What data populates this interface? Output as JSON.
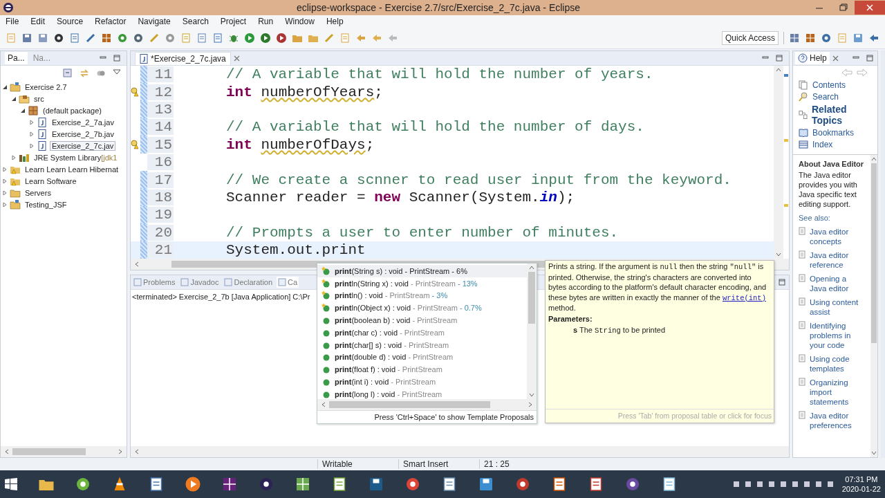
{
  "window": {
    "title": "eclipse-workspace - Exercise 2.7/src/Exercise_2_7c.java - Eclipse"
  },
  "menu": [
    "File",
    "Edit",
    "Source",
    "Refactor",
    "Navigate",
    "Search",
    "Project",
    "Run",
    "Window",
    "Help"
  ],
  "toolbar": {
    "quick_access": "Quick Access"
  },
  "package_explorer": {
    "tabs": [
      {
        "label": "Pa...",
        "selected": true
      },
      {
        "label": "Na...",
        "selected": false
      }
    ],
    "tree": [
      {
        "label": "Exercise 2.7",
        "kind": "project",
        "expanded": true,
        "selected": false,
        "children": [
          {
            "label": "src",
            "kind": "source-folder",
            "expanded": true,
            "selected": false,
            "children": [
              {
                "label": "(default package)",
                "kind": "package",
                "expanded": true,
                "selected": false,
                "children": [
                  {
                    "label": "Exercise_2_7a.jav",
                    "kind": "java-file",
                    "expanded": false,
                    "selected": false
                  },
                  {
                    "label": "Exercise_2_7b.jav",
                    "kind": "java-file",
                    "expanded": false,
                    "selected": false
                  },
                  {
                    "label": "Exercise_2_7c.jav",
                    "kind": "java-file",
                    "expanded": false,
                    "selected": true
                  }
                ]
              }
            ]
          },
          {
            "label": "JRE System Library",
            "suffix": "[jdk1",
            "kind": "library",
            "expanded": false,
            "selected": false
          }
        ]
      },
      {
        "label": "Learn Learn Learn Hibernat",
        "kind": "warning-project",
        "expanded": false,
        "selected": false
      },
      {
        "label": "Learn Software",
        "kind": "warning-project",
        "expanded": false,
        "selected": false
      },
      {
        "label": "Servers",
        "kind": "folder",
        "expanded": false,
        "selected": false
      },
      {
        "label": "Testing_JSF",
        "kind": "project",
        "expanded": false,
        "selected": false
      }
    ]
  },
  "editor": {
    "tab": "*Exercise_2_7c.java",
    "lines": [
      {
        "number": "11",
        "changed": true,
        "warning": false,
        "current": false,
        "tokens": [
          {
            "text": "// A variable that will hold the number of years.",
            "kind": "comment"
          }
        ]
      },
      {
        "number": "12",
        "changed": true,
        "warning": true,
        "current": false,
        "tokens": [
          {
            "text": "int ",
            "kind": "keyword"
          },
          {
            "text": "numberOfYears",
            "kind": "warning"
          },
          {
            "text": ";",
            "kind": "plain"
          }
        ]
      },
      {
        "number": "13",
        "changed": true,
        "warning": false,
        "current": false
      },
      {
        "number": "14",
        "changed": true,
        "warning": false,
        "current": false,
        "tokens": [
          {
            "text": "// A variable that will hold the number of days.",
            "kind": "comment"
          }
        ]
      },
      {
        "number": "15",
        "changed": true,
        "warning": true,
        "current": false,
        "tokens": [
          {
            "text": "int ",
            "kind": "keyword"
          },
          {
            "text": "numberOfDays",
            "kind": "warning"
          },
          {
            "text": ";",
            "kind": "plain"
          }
        ]
      },
      {
        "number": "16",
        "changed": false,
        "warning": false,
        "current": false
      },
      {
        "number": "17",
        "changed": true,
        "warning": false,
        "current": false,
        "tokens": [
          {
            "text": "// We create a scnner to read user input from the keyword.",
            "kind": "comment"
          }
        ]
      },
      {
        "number": "18",
        "changed": true,
        "warning": false,
        "current": false,
        "tokens": [
          {
            "text": "Scanner reader = ",
            "kind": "plain"
          },
          {
            "text": "new",
            "kind": "keyword"
          },
          {
            "text": " Scanner(System.",
            "kind": "plain"
          },
          {
            "text": "in",
            "kind": "static-field"
          },
          {
            "text": ");",
            "kind": "plain"
          }
        ]
      },
      {
        "number": "19",
        "changed": true,
        "warning": false,
        "current": false
      },
      {
        "number": "20",
        "changed": true,
        "warning": false,
        "current": false,
        "tokens": [
          {
            "text": "// Prompts a user to enter number of minutes.",
            "kind": "comment"
          }
        ]
      },
      {
        "number": "21",
        "changed": true,
        "warning": false,
        "current": true,
        "tokens": [
          {
            "text": "System.out.print",
            "kind": "plain"
          }
        ]
      }
    ]
  },
  "bottom_panel": {
    "tabs": [
      {
        "label": "Problems",
        "selected": false
      },
      {
        "label": "Javadoc",
        "selected": false
      },
      {
        "label": "Declaration",
        "selected": false
      },
      {
        "label": "Ca",
        "selected": true
      }
    ],
    "console": "<terminated> Exercise_2_7b [Java Application] C:\\Pr"
  },
  "content_assist": {
    "proposals": [
      {
        "name": "print",
        "signature": "(String s) : void",
        "type": "- PrintStream",
        "percent": "- 6%",
        "starred": true,
        "selected": true
      },
      {
        "name": "print",
        "signature": "ln(String x) : void",
        "type": "- PrintStream",
        "percent": "- 13%",
        "starred": true,
        "selected": false
      },
      {
        "name": "print",
        "signature": "ln() : void",
        "type": "- PrintStream",
        "percent": "- 3%",
        "starred": true,
        "selected": false
      },
      {
        "name": "print",
        "signature": "ln(Object x) : void",
        "type": "- PrintStream",
        "percent": "- 0.7%",
        "starred": true,
        "selected": false
      },
      {
        "name": "print",
        "signature": "(boolean b) : void",
        "type": "- PrintStream",
        "starred": false,
        "selected": false
      },
      {
        "name": "print",
        "signature": "(char c) : void",
        "type": "- PrintStream",
        "starred": false,
        "selected": false
      },
      {
        "name": "print",
        "signature": "(char[] s) : void",
        "type": "- PrintStream",
        "starred": false,
        "selected": false
      },
      {
        "name": "print",
        "signature": "(double d) : void",
        "type": "- PrintStream",
        "starred": false,
        "selected": false
      },
      {
        "name": "print",
        "signature": "(float f) : void",
        "type": "- PrintStream",
        "starred": false,
        "selected": false
      },
      {
        "name": "print",
        "signature": "(int i) : void",
        "type": "- PrintStream",
        "starred": false,
        "selected": false
      },
      {
        "name": "print",
        "signature": "(long l) : void",
        "type": "- PrintStream",
        "starred": false,
        "selected": false
      }
    ],
    "footer": "Press 'Ctrl+Space' to show Template Proposals",
    "doc": {
      "description": [
        {
          "text": "Prints a string. If the argument is ",
          "kind": "text"
        },
        {
          "text": "null",
          "kind": "code"
        },
        {
          "text": " then the string ",
          "kind": "text"
        },
        {
          "text": "\"null\"",
          "kind": "code"
        },
        {
          "text": " is printed. Otherwise, the string's characters are converted into bytes according to the platform's default character encoding, and these bytes are written in exactly the manner of the ",
          "kind": "text"
        },
        {
          "text": "write(int)",
          "kind": "link"
        },
        {
          "text": " method.",
          "kind": "text"
        }
      ],
      "parameters_heading": "Parameters:",
      "parameter_name": "s",
      "parameter_description": [
        {
          "text": "The ",
          "kind": "text"
        },
        {
          "text": "String",
          "kind": "code"
        },
        {
          "text": " to be printed",
          "kind": "text"
        }
      ],
      "footer": "Press 'Tab' from proposal table or click for focus"
    }
  },
  "help": {
    "tab": "Help",
    "nav": [
      {
        "label": "Contents",
        "kind": "contents"
      },
      {
        "label": "Search",
        "kind": "search"
      },
      {
        "label": "Related Topics",
        "kind": "related"
      },
      {
        "label": "Bookmarks",
        "kind": "bookmarks"
      },
      {
        "label": "Index",
        "kind": "index"
      }
    ],
    "about_heading": "About Java Editor",
    "about_text": "The Java editor provides you with Java specific text editing support.",
    "see_also": "See also:",
    "links": [
      "Java editor concepts",
      "Java editor reference",
      "Opening a Java editor",
      "Using content assist",
      "Identifying problems in your code",
      "Using code templates",
      "Organizing import statements",
      "Java editor preferences"
    ]
  },
  "status_bar": [
    "Writable",
    "Smart Insert",
    "21 : 25"
  ],
  "taskbar": {
    "time": "07:31 PM",
    "date": "2020-01-22"
  }
}
